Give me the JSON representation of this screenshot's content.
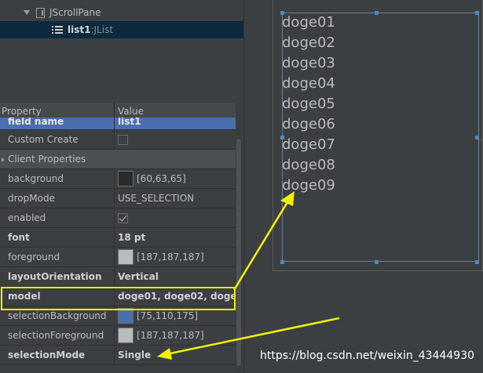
{
  "tree": {
    "scrollpane_label": "JScrollPane",
    "list_name": "list1",
    "list_separator": " : ",
    "list_type": "JList"
  },
  "properties": {
    "header_property": "Property",
    "header_value": "Value",
    "rows": [
      {
        "name": "field name",
        "value": "list1"
      },
      {
        "name": "Custom Create",
        "value": ""
      },
      {
        "name": "Client Properties",
        "value": ""
      },
      {
        "name": "background",
        "value": "[60,63,65]",
        "swatch": "#2b2b2b"
      },
      {
        "name": "dropMode",
        "value": "USE_SELECTION"
      },
      {
        "name": "enabled",
        "value": ""
      },
      {
        "name": "font",
        "value": "18 pt"
      },
      {
        "name": "foreground",
        "value": "[187,187,187]",
        "swatch": "#bbbbbb"
      },
      {
        "name": "layoutOrientation",
        "value": "Vertical"
      },
      {
        "name": "model",
        "value": "doge01, doge02, doge…"
      },
      {
        "name": "selectionBackground",
        "value": "[75,110,175]",
        "swatch": "#4b6eaf"
      },
      {
        "name": "selectionForeground",
        "value": "[187,187,187]",
        "swatch": "#bbbbbb"
      },
      {
        "name": "selectionMode",
        "value": "Single"
      }
    ]
  },
  "list_items": [
    "doge01",
    "doge02",
    "doge03",
    "doge04",
    "doge05",
    "doge06",
    "doge07",
    "doge08",
    "doge09"
  ],
  "watermark": "https://blog.csdn.net/weixin_43444930",
  "colors": {
    "highlight": "#f2f200",
    "selection": "#4b6eaf",
    "handle": "#4a88c7"
  }
}
